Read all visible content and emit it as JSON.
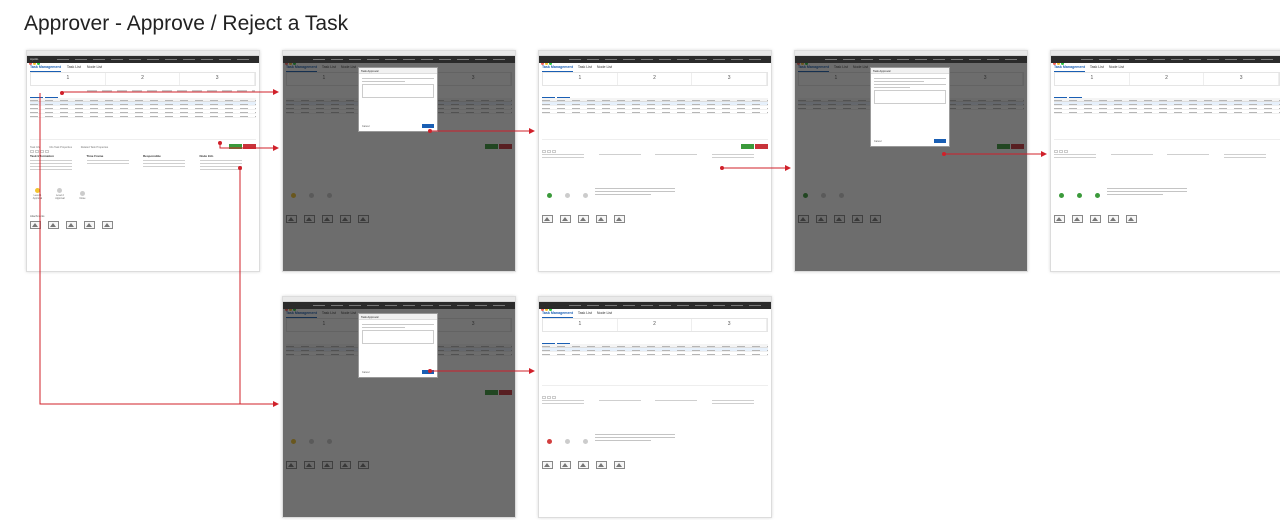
{
  "title": "Approver - Approve / Reject a Task",
  "screen_ui": {
    "brand": "Apollo",
    "tabs": [
      "Task Management",
      "Task List",
      "Node List"
    ],
    "detail_tabs": [
      "Task Info",
      "Info Task Properties",
      "Related Task Properties"
    ],
    "column_heads": [
      "Task Information",
      "Time Frame",
      "Responsible",
      "Node Info"
    ],
    "approval_steps": [
      "Level 1 Approval",
      "Level 2 Approval",
      "Close"
    ],
    "attachments_label": "Attachments",
    "modal_title": "Task Approval",
    "modal_cancel": "Cancel"
  },
  "colors": {
    "connector": "#d0202a",
    "primary": "#1a5fb4",
    "approve": "#3b9a3b",
    "reject": "#c8333a"
  }
}
